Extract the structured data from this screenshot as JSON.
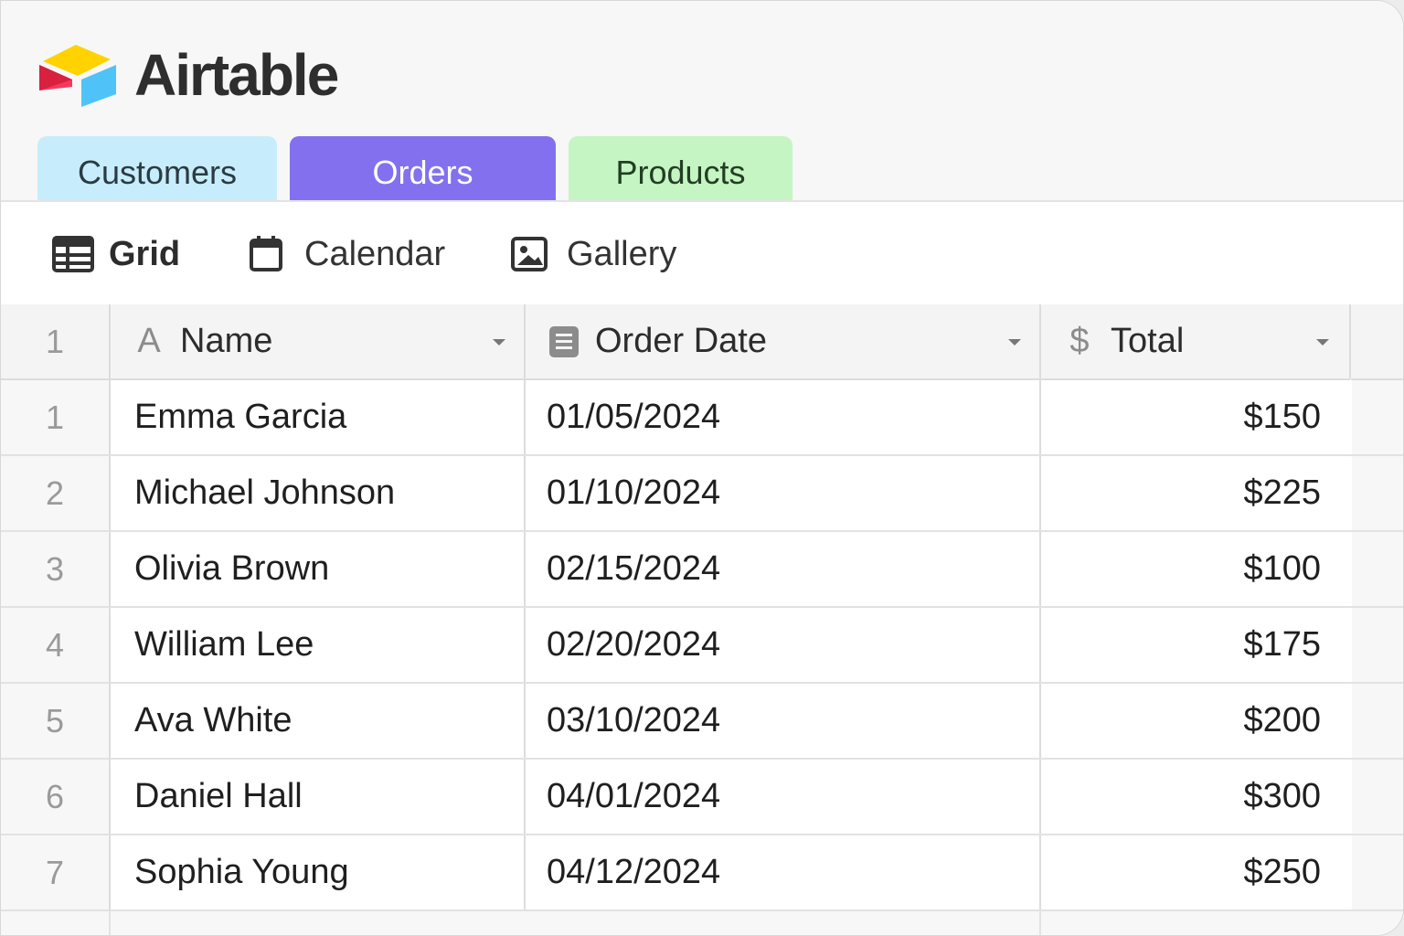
{
  "app": {
    "brand": "Airtable",
    "logo_icon": "airtable-logo-icon"
  },
  "tabs": [
    {
      "label": "Customers",
      "color": "#c7edfc",
      "active": false
    },
    {
      "label": "Orders",
      "color": "#8370ef",
      "active": true
    },
    {
      "label": "Products",
      "color": "#c5f5c2",
      "active": false
    }
  ],
  "views": [
    {
      "label": "Grid",
      "icon": "grid-icon",
      "active": true
    },
    {
      "label": "Calendar",
      "icon": "calendar-icon",
      "active": false
    },
    {
      "label": "Gallery",
      "icon": "gallery-icon",
      "active": false
    }
  ],
  "table": {
    "header_row_number": "1",
    "columns": [
      {
        "label": "Name",
        "type_icon": "text-field-icon",
        "type_glyph": "A"
      },
      {
        "label": "Order Date",
        "type_icon": "date-field-icon"
      },
      {
        "label": "Total",
        "type_icon": "currency-field-icon",
        "type_glyph": "$"
      }
    ],
    "rows": [
      {
        "num": "1",
        "name": "Emma Garcia",
        "date": "01/05/2024",
        "total": "$150"
      },
      {
        "num": "2",
        "name": "Michael Johnson",
        "date": "01/10/2024",
        "total": "$225"
      },
      {
        "num": "3",
        "name": "Olivia Brown",
        "date": "02/15/2024",
        "total": "$100"
      },
      {
        "num": "4",
        "name": "William Lee",
        "date": "02/20/2024",
        "total": "$175"
      },
      {
        "num": "5",
        "name": "Ava White",
        "date": "03/10/2024",
        "total": "$200"
      },
      {
        "num": "6",
        "name": "Daniel Hall",
        "date": "04/01/2024",
        "total": "$300"
      },
      {
        "num": "7",
        "name": "Sophia Young",
        "date": "04/12/2024",
        "total": "$250"
      }
    ]
  }
}
